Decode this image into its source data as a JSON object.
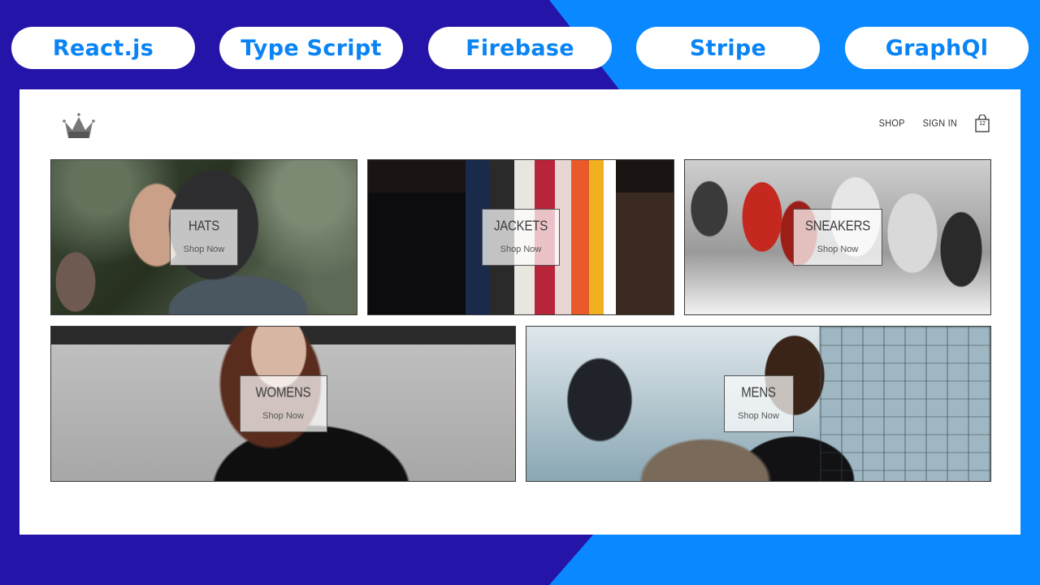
{
  "tech_pills": [
    "React.js",
    "Type Script",
    "Firebase",
    "Stripe",
    "GraphQl"
  ],
  "header": {
    "logo_icon": "crown-icon",
    "nav": {
      "shop": "SHOP",
      "sign_in": "SIGN IN"
    },
    "cart": {
      "icon": "shopping-bag-icon",
      "count": "12"
    }
  },
  "categories": [
    {
      "title": "HATS",
      "cta": "Shop Now"
    },
    {
      "title": "JACKETS",
      "cta": "Shop Now"
    },
    {
      "title": "SNEAKERS",
      "cta": "Shop Now"
    },
    {
      "title": "WOMENS",
      "cta": "Shop Now"
    },
    {
      "title": "MENS",
      "cta": "Shop Now"
    }
  ],
  "colors": {
    "bg_left": "#2414a8",
    "bg_right": "#0a88ff",
    "pill_text": "#0a84f5"
  }
}
